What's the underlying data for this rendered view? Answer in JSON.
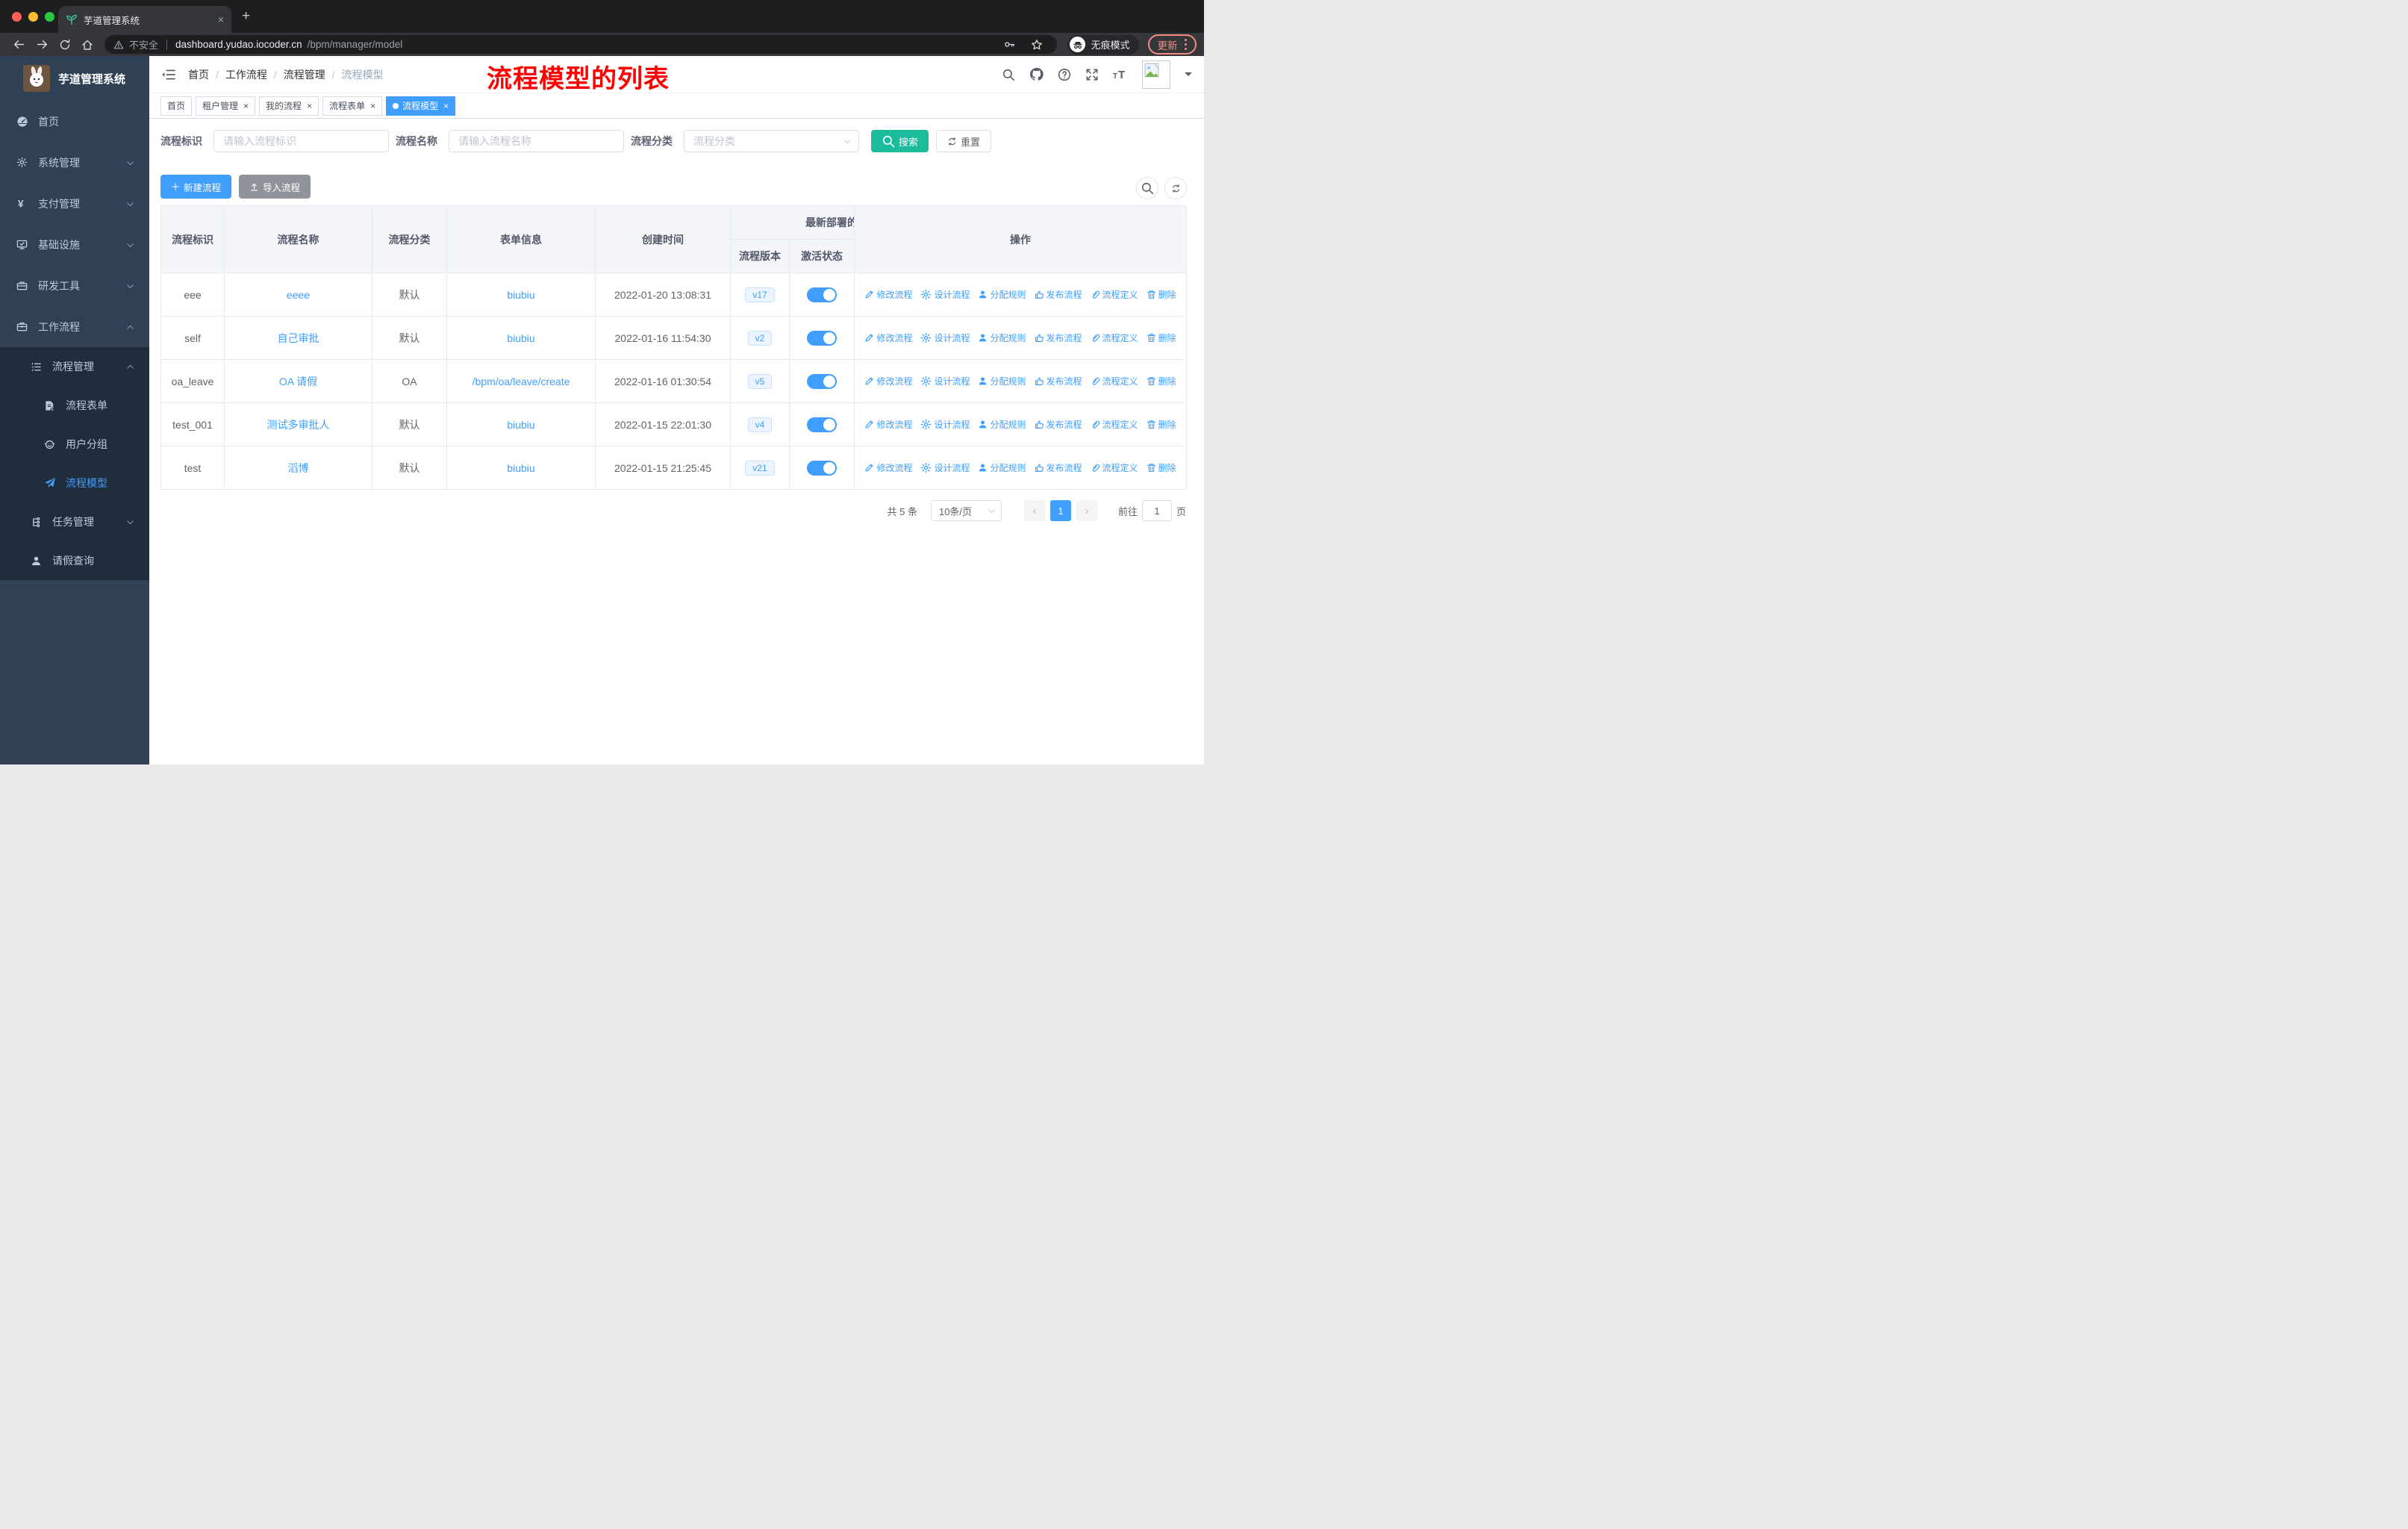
{
  "colors": {
    "primary": "#409eff",
    "search_teal": "#1abc9c",
    "info_gray": "#909399",
    "annotation_red": "#ff0000",
    "sidebar_bg": "#304156",
    "submenu_bg": "#1f2d3d",
    "chrome_update": "#f28b82"
  },
  "browser": {
    "tab": {
      "title": "芋道管理系统",
      "close": "×",
      "new_tab": "+"
    },
    "address": {
      "security": "不安全",
      "host": "dashboard.yudao.iocoder.cn",
      "path": "/bpm/manager/model"
    },
    "incognito": "无痕模式",
    "update": "更新"
  },
  "sidebar": {
    "title": "芋道管理系统",
    "menu": [
      {
        "label": "首页",
        "icon": "dashboard-icon",
        "level": 0,
        "chevron": "",
        "active": false,
        "sub": false
      },
      {
        "label": "系统管理",
        "icon": "gear-icon",
        "level": 0,
        "chevron": "down",
        "active": false,
        "sub": false
      },
      {
        "label": "支付管理",
        "icon": "yen-icon",
        "level": 0,
        "chevron": "down",
        "active": false,
        "sub": false
      },
      {
        "label": "基础设施",
        "icon": "monitor-icon",
        "level": 0,
        "chevron": "down",
        "active": false,
        "sub": false
      },
      {
        "label": "研发工具",
        "icon": "toolbox-icon",
        "level": 0,
        "chevron": "down",
        "active": false,
        "sub": false
      },
      {
        "label": "工作流程",
        "icon": "briefcase-icon",
        "level": 0,
        "chevron": "up",
        "active": false,
        "sub": false
      },
      {
        "label": "流程管理",
        "icon": "tree-list-icon",
        "level": 1,
        "chevron": "up",
        "active": false,
        "sub": true
      },
      {
        "label": "流程表单",
        "icon": "form-doc-icon",
        "level": 2,
        "chevron": "",
        "active": false,
        "sub": true
      },
      {
        "label": "用户分组",
        "icon": "user-group-icon",
        "level": 2,
        "chevron": "",
        "active": false,
        "sub": true
      },
      {
        "label": "流程模型",
        "icon": "paper-plane-icon",
        "level": 2,
        "chevron": "",
        "active": true,
        "sub": true
      },
      {
        "label": "任务管理",
        "icon": "org-tree-icon",
        "level": 1,
        "chevron": "down",
        "active": false,
        "sub": true
      },
      {
        "label": "请假查询",
        "icon": "person-icon",
        "level": 1,
        "chevron": "",
        "active": false,
        "sub": true
      }
    ]
  },
  "navbar": {
    "breadcrumb": [
      "首页",
      "工作流程",
      "流程管理",
      "流程模型"
    ],
    "annotation": "流程模型的列表"
  },
  "tags": [
    {
      "label": "首页",
      "closable": false,
      "active": false
    },
    {
      "label": "租户管理",
      "closable": true,
      "active": false
    },
    {
      "label": "我的流程",
      "closable": true,
      "active": false
    },
    {
      "label": "流程表单",
      "closable": true,
      "active": false
    },
    {
      "label": "流程模型",
      "closable": true,
      "active": true
    }
  ],
  "filters": {
    "process_key": {
      "label": "流程标识",
      "placeholder": "请输入流程标识"
    },
    "process_name": {
      "label": "流程名称",
      "placeholder": "请输入流程名称"
    },
    "category": {
      "label": "流程分类",
      "placeholder": "流程分类"
    },
    "search": "搜索",
    "reset": "重置"
  },
  "toolbar": {
    "create": "新建流程",
    "import": "导入流程"
  },
  "table": {
    "columns": [
      "流程标识",
      "流程名称",
      "流程分类",
      "表单信息",
      "创建时间"
    ],
    "group_header": "最新部署的",
    "group_children": [
      "流程版本",
      "激活状态"
    ],
    "op_header": "操作",
    "actions": [
      {
        "id": "edit",
        "label": "修改流程",
        "icon": "edit-icon"
      },
      {
        "id": "design",
        "label": "设计流程",
        "icon": "gear-icon"
      },
      {
        "id": "assign",
        "label": "分配规则",
        "icon": "user-icon"
      },
      {
        "id": "publish",
        "label": "发布流程",
        "icon": "thumb-icon"
      },
      {
        "id": "definition",
        "label": "流程定义",
        "icon": "link-icon"
      },
      {
        "id": "delete",
        "label": "删除",
        "icon": "trash-icon"
      }
    ],
    "rows": [
      {
        "key": "eee",
        "name": "eeee",
        "category": "默认",
        "form": "biubiu",
        "created": "2022-01-20 13:08:31",
        "version": "v17",
        "active": true
      },
      {
        "key": "self",
        "name": "自己审批",
        "category": "默认",
        "form": "biubiu",
        "created": "2022-01-16 11:54:30",
        "version": "v2",
        "active": true
      },
      {
        "key": "oa_leave",
        "name": "OA 请假",
        "category": "OA",
        "form": "/bpm/oa/leave/create",
        "created": "2022-01-16 01:30:54",
        "version": "v5",
        "active": true
      },
      {
        "key": "test_001",
        "name": "测试多审批人",
        "category": "默认",
        "form": "biubiu",
        "created": "2022-01-15 22:01:30",
        "version": "v4",
        "active": true
      },
      {
        "key": "test",
        "name": "滔博",
        "category": "默认",
        "form": "biubiu",
        "created": "2022-01-15 21:25:45",
        "version": "v21",
        "active": true
      }
    ]
  },
  "pagination": {
    "total": "共 5 条",
    "page_size": "10条/页",
    "page": "1",
    "prev": "‹",
    "next": "›",
    "goto": "前往",
    "goto_value": "1",
    "unit": "页"
  }
}
